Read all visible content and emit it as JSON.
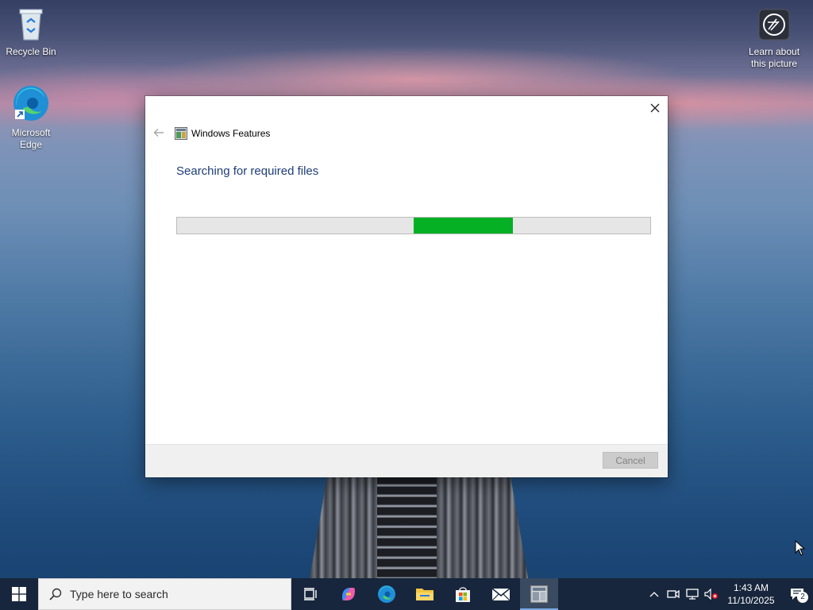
{
  "desktop": {
    "icons": [
      {
        "label": "Recycle Bin"
      },
      {
        "label": "Microsoft Edge"
      }
    ],
    "learn_about": {
      "label": "Learn about this picture"
    }
  },
  "dialog": {
    "title": "Windows Features",
    "heading": "Searching for required files",
    "progress": {
      "indeterminate": true,
      "segment_start_fraction": 0.5,
      "segment_width_fraction": 0.21,
      "color": "#06b025"
    },
    "cancel_label": "Cancel",
    "cancel_enabled": false
  },
  "taskbar": {
    "search_placeholder": "Type here to search",
    "pinned": [
      {
        "icon": "task-view-icon"
      },
      {
        "icon": "copilot-icon"
      },
      {
        "icon": "edge-icon"
      },
      {
        "icon": "file-explorer-icon"
      },
      {
        "icon": "store-icon"
      },
      {
        "icon": "mail-icon"
      },
      {
        "icon": "windows-features-icon",
        "active": true
      }
    ],
    "clock": {
      "time": "1:43 AM",
      "date": "11/10/2025"
    },
    "notification_count": "2"
  },
  "colors": {
    "taskbar_bg": "#17263c",
    "heading": "#1e3d78",
    "progress_fill": "#06b025"
  }
}
